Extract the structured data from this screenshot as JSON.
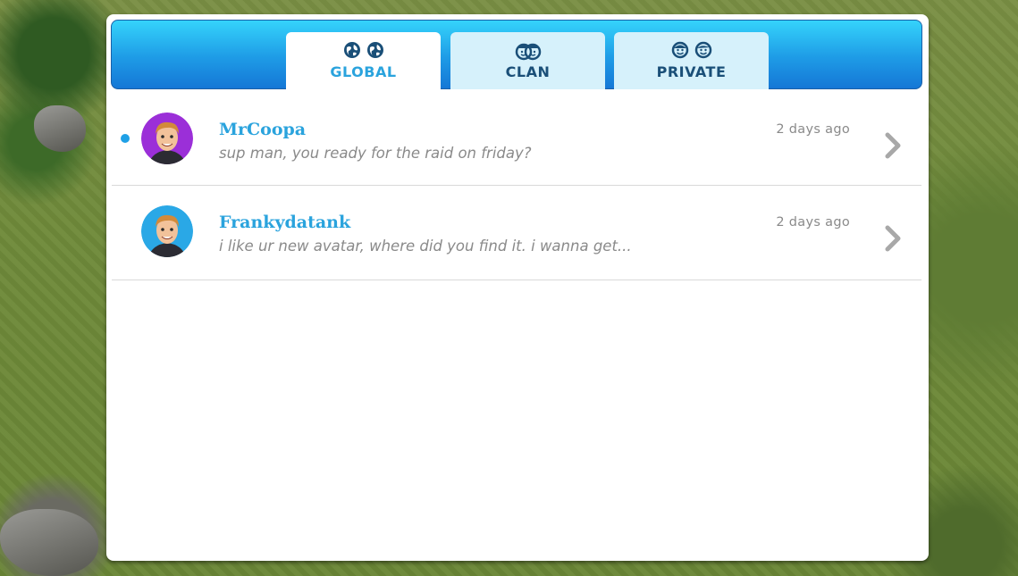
{
  "tabs": [
    {
      "label": "GLOBAL",
      "icon": "globe-icon",
      "active": true
    },
    {
      "label": "CLAN",
      "icon": "clan-icon",
      "active": false
    },
    {
      "label": "PRIVATE",
      "icon": "smiley-faces-icon",
      "active": false
    }
  ],
  "conversations": [
    {
      "name": "MrCoopa",
      "message": "sup man, you ready for the raid on friday?",
      "time": "2 days ago",
      "unread": true,
      "avatar_color": "#9b2fd8"
    },
    {
      "name": "Frankydatank",
      "message": "i like ur new avatar, where did you find it. i wanna get...",
      "time": "2 days ago",
      "unread": false,
      "avatar_color": "#2aa8e6"
    }
  ],
  "colors": {
    "accent": "#2aa3dd",
    "tab_inactive": "#d6f1fb",
    "unread_dot": "#1fa0e6"
  }
}
